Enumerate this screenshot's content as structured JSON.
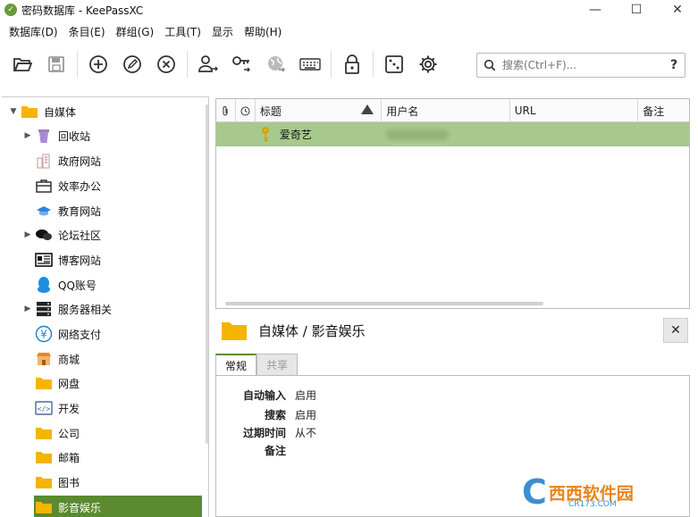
{
  "window": {
    "title": "密码数据库 - KeePassXC",
    "minimize": "—",
    "maximize": "☐",
    "close": "✕"
  },
  "menu": [
    "数据库(D)",
    "条目(E)",
    "群组(G)",
    "工具(T)",
    "显示",
    "帮助(H)"
  ],
  "search": {
    "placeholder": "搜索(Ctrl+F)...",
    "help": "?"
  },
  "tree": {
    "root": "自媒体",
    "items": [
      {
        "label": "回收站",
        "icon": "recycle-bin-icon"
      },
      {
        "label": "政府网站",
        "icon": "building-icon"
      },
      {
        "label": "效率办公",
        "icon": "briefcase-icon"
      },
      {
        "label": "教育网站",
        "icon": "graduation-cap-icon"
      },
      {
        "label": "论坛社区",
        "icon": "chat-bubbles-icon"
      },
      {
        "label": "博客网站",
        "icon": "newspaper-icon"
      },
      {
        "label": "QQ账号",
        "icon": "penguin-icon"
      },
      {
        "label": "服务器相关",
        "icon": "server-icon"
      },
      {
        "label": "网络支付",
        "icon": "yen-icon"
      },
      {
        "label": "商城",
        "icon": "shop-icon"
      },
      {
        "label": "网盘",
        "icon": "folder-icon"
      },
      {
        "label": "开发",
        "icon": "code-icon"
      },
      {
        "label": "公司",
        "icon": "folder-icon"
      },
      {
        "label": "邮箱",
        "icon": "folder-icon"
      },
      {
        "label": "图书",
        "icon": "folder-icon"
      },
      {
        "label": "影音娱乐",
        "icon": "folder-icon"
      }
    ]
  },
  "table": {
    "headers": {
      "title": "标题",
      "username": "用户名",
      "url": "URL",
      "notes": "备注"
    },
    "rows": [
      {
        "title": "爱奇艺"
      }
    ]
  },
  "details": {
    "path": "自媒体 / 影音娱乐",
    "close": "✕",
    "tabs": [
      "常规",
      "共享"
    ],
    "props": [
      {
        "key": "自动输入",
        "value": "启用"
      },
      {
        "key": "搜索",
        "value": "启用"
      },
      {
        "key": "过期时间",
        "value": "从不"
      },
      {
        "key": "备注",
        "value": ""
      }
    ]
  },
  "watermark": {
    "text": "西西软件园",
    "sub": "CR173.COM"
  },
  "colors": {
    "accent": "#5b8a2f",
    "row_selected": "#a8c98e",
    "folder": "#f5b400"
  }
}
